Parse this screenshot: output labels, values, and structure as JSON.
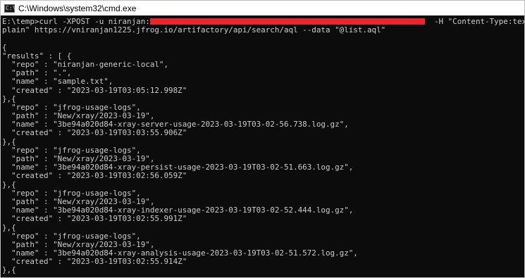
{
  "window": {
    "title": "C:\\Windows\\system32\\cmd.exe",
    "icon_glyph": "C:\\",
    "icon_name": "cmd-icon"
  },
  "console": {
    "cmd_before_redaction": "E:\\temp>curl -XPOST -u niranjan:",
    "cmd_after_redaction": "  -H \"Content-Type:text/",
    "cmd_line2": "plain\" https://vniranjan1225.jfrog.io/artifactory/api/search/aql --data \"@list.aql\"",
    "redaction_color": "#e8262e",
    "output_lines": [
      "{",
      "\"results\" : [ {",
      "  \"repo\" : \"niranjan-generic-local\",",
      "  \"path\" : \".\",",
      "  \"name\" : \"sample.txt\",",
      "  \"created\" : \"2023-03-19T03:05:12.998Z\"",
      "},{",
      "  \"repo\" : \"jfrog-usage-logs\",",
      "  \"path\" : \"New/xray/2023-03-19\",",
      "  \"name\" : \"3be94a020d84-xray-server-usage-2023-03-19T03-02-56.738.log.gz\",",
      "  \"created\" : \"2023-03-19T03:03:55.906Z\"",
      "},{",
      "  \"repo\" : \"jfrog-usage-logs\",",
      "  \"path\" : \"New/xray/2023-03-19\",",
      "  \"name\" : \"3be94a020d84-xray-persist-usage-2023-03-19T03-02-51.663.log.gz\",",
      "  \"created\" : \"2023-03-19T03:02:56.059Z\"",
      "},{",
      "  \"repo\" : \"jfrog-usage-logs\",",
      "  \"path\" : \"New/xray/2023-03-19\",",
      "  \"name\" : \"3be94a020d84-xray-indexer-usage-2023-03-19T03-02-52.444.log.gz\",",
      "  \"created\" : \"2023-03-19T03:02:55.991Z\"",
      "},{",
      "  \"repo\" : \"jfrog-usage-logs\",",
      "  \"path\" : \"New/xray/2023-03-19\",",
      "  \"name\" : \"3be94a020d84-xray-analysis-usage-2023-03-19T03-02-51.572.log.gz\",",
      "  \"created\" : \"2023-03-19T03:02:55.914Z\"",
      "},{"
    ]
  }
}
